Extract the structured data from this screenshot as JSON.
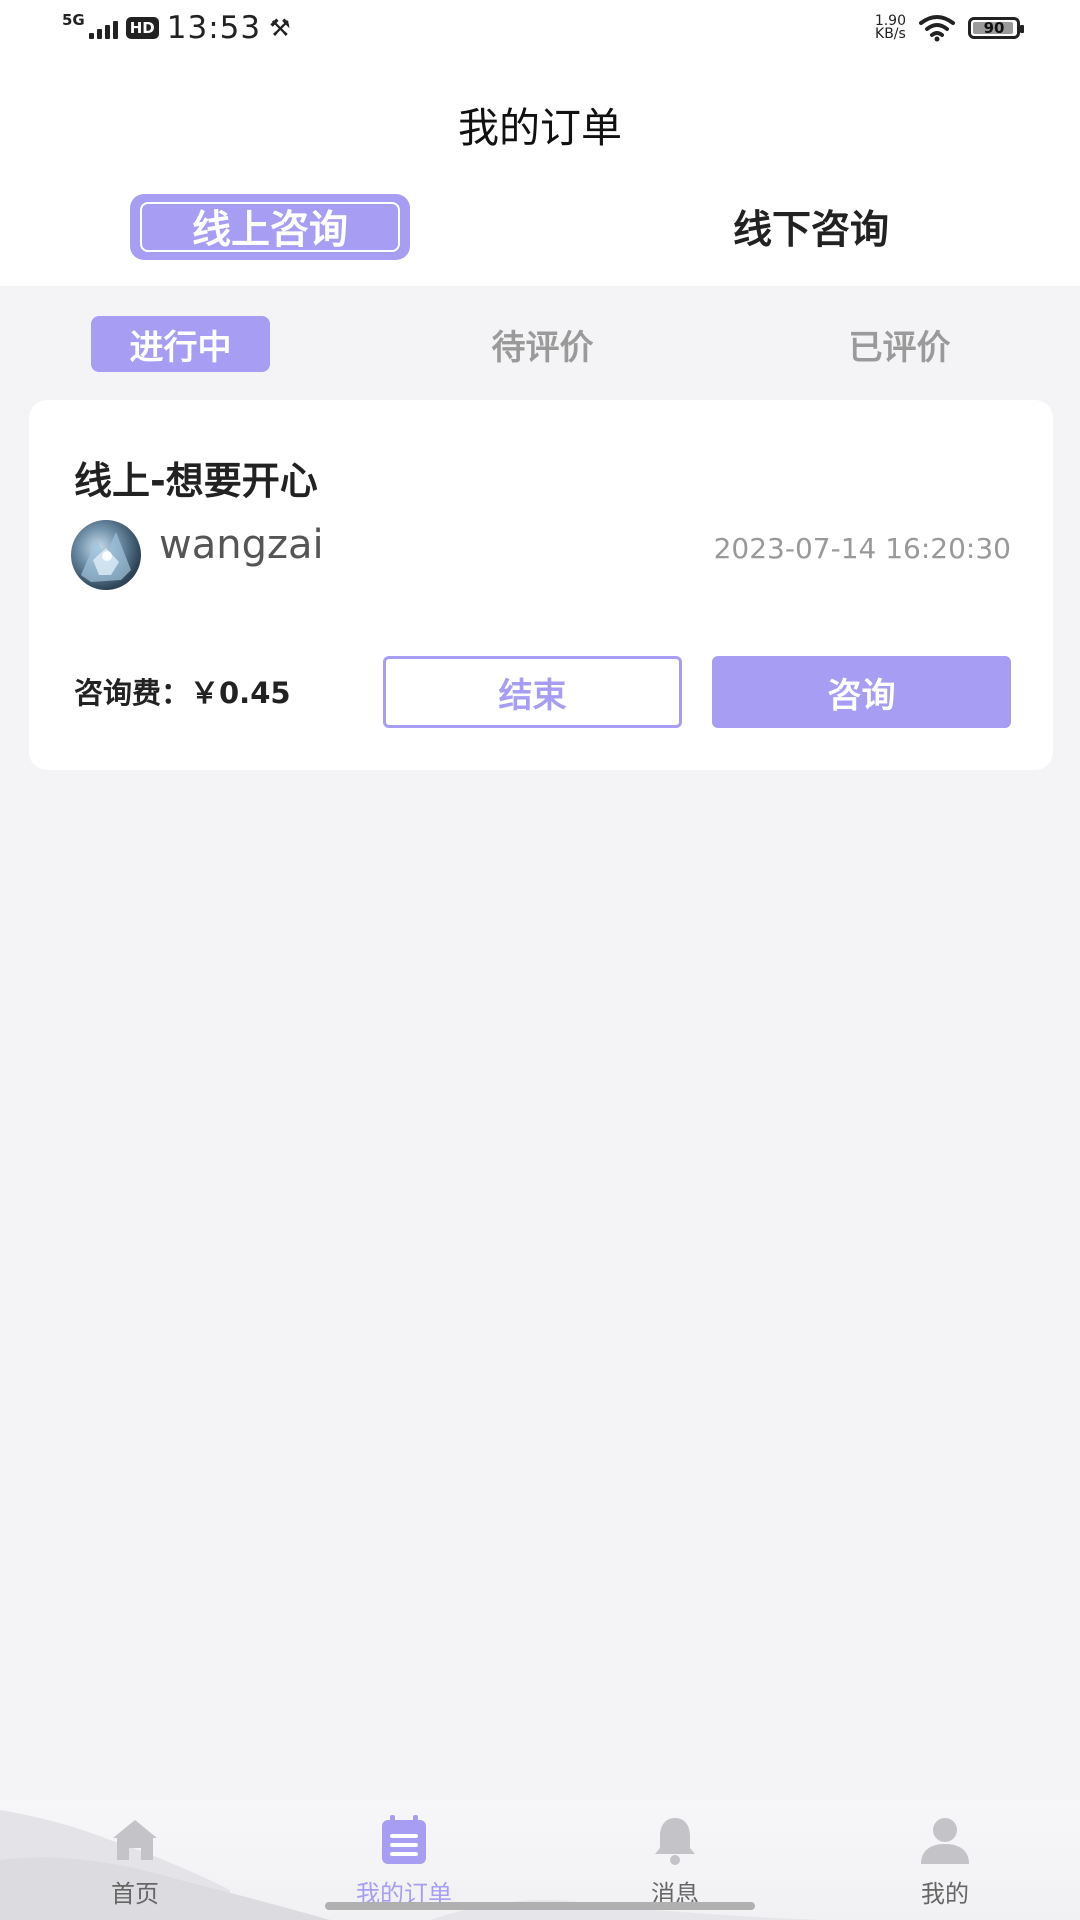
{
  "status_bar": {
    "network": "5G",
    "hd": "HD",
    "time": "13:53",
    "speed_value": "1.90",
    "speed_unit": "KB/s",
    "battery": "90"
  },
  "header": {
    "title": "我的订单",
    "tabs": [
      {
        "label": "线上咨询",
        "active": true
      },
      {
        "label": "线下咨询",
        "active": false
      }
    ]
  },
  "subtabs": [
    {
      "label": "进行中",
      "active": true
    },
    {
      "label": "待评价",
      "active": false
    },
    {
      "label": "已评价",
      "active": false
    }
  ],
  "orders": [
    {
      "title": "线上-想要开心",
      "username": "wangzai",
      "time": "2023-07-14 16:20:30",
      "fee": "咨询费：￥0.45",
      "end_label": "结束",
      "consult_label": "咨询"
    }
  ],
  "bottom_nav": {
    "items": [
      {
        "label": "首页",
        "icon": "home-icon",
        "active": false
      },
      {
        "label": "我的订单",
        "icon": "orders-icon",
        "active": true
      },
      {
        "label": "消息",
        "icon": "bell-icon",
        "active": false
      },
      {
        "label": "我的",
        "icon": "person-icon",
        "active": false
      }
    ]
  },
  "colors": {
    "accent": "#a79ef4",
    "background": "#f4f4f6"
  }
}
